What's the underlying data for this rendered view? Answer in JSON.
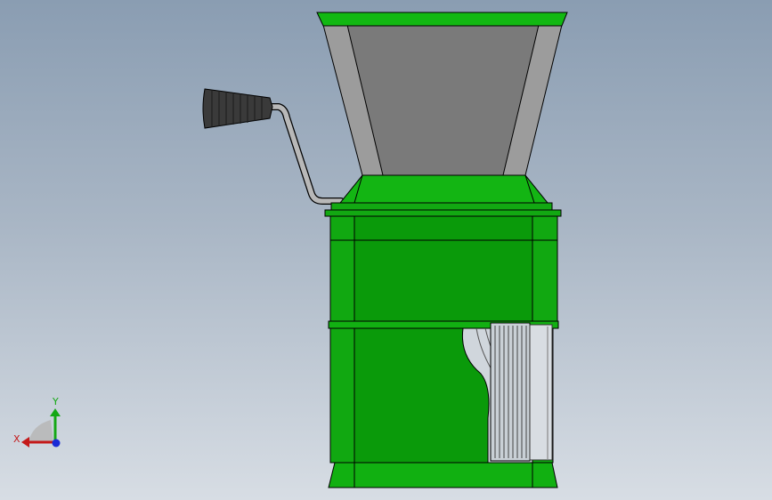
{
  "triad": {
    "x_label": "X",
    "y_label": "Y"
  },
  "colors": {
    "body_green": "#15c215",
    "body_green_dark": "#0e8f0e",
    "hopper_gray": "#7b7b7b",
    "hopper_side": "#a7a7a7",
    "handle_knob": "#3b3b3b",
    "axis_x": "#c41a1a",
    "axis_y": "#14a814",
    "axis_z": "#1a2ad6"
  },
  "icons": {
    "triad": "coordinate-triad-icon"
  }
}
